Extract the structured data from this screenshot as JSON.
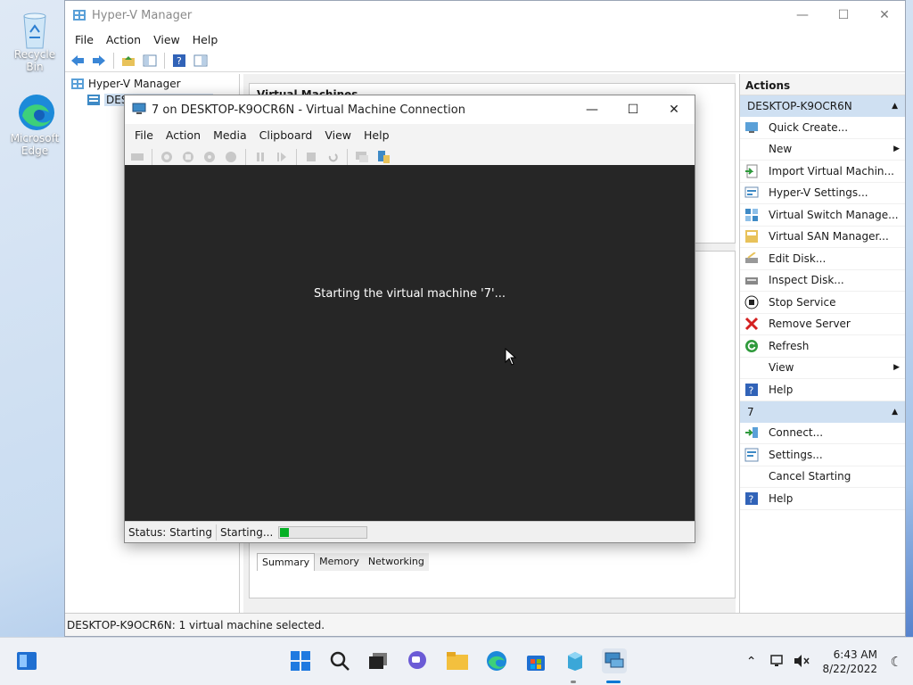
{
  "desktop": {
    "icons": [
      {
        "label": "Recycle Bin",
        "icon": "recycle-bin-icon"
      },
      {
        "label": "Microsoft Edge",
        "icon": "edge-icon"
      }
    ]
  },
  "hyperv": {
    "title": "Hyper-V Manager",
    "menu": [
      "File",
      "Action",
      "View",
      "Help"
    ],
    "tree": {
      "root": "Hyper-V Manager",
      "child": "DESKTOP-K9OCR6N"
    },
    "center": {
      "vm_header": "Virtual Machines",
      "tabs": [
        "Summary",
        "Memory",
        "Networking"
      ]
    },
    "actions": {
      "header": "Actions",
      "server_section": "DESKTOP-K9OCR6N",
      "server_items": [
        {
          "label": "Quick Create...",
          "icon": "quick-create-icon"
        },
        {
          "label": "New",
          "icon": "",
          "submenu": true
        },
        {
          "label": "Import Virtual Machin...",
          "icon": "import-vm-icon"
        },
        {
          "label": "Hyper-V Settings...",
          "icon": "hyperv-settings-icon"
        },
        {
          "label": "Virtual Switch Manage...",
          "icon": "virtual-switch-icon"
        },
        {
          "label": "Virtual SAN Manager...",
          "icon": "virtual-san-icon"
        },
        {
          "label": "Edit Disk...",
          "icon": "edit-disk-icon"
        },
        {
          "label": "Inspect Disk...",
          "icon": "inspect-disk-icon"
        },
        {
          "label": "Stop Service",
          "icon": "stop-service-icon"
        },
        {
          "label": "Remove Server",
          "icon": "remove-server-icon"
        },
        {
          "label": "Refresh",
          "icon": "refresh-icon"
        },
        {
          "label": "View",
          "icon": "",
          "submenu": true
        },
        {
          "label": "Help",
          "icon": "help-icon"
        }
      ],
      "vm_section": "7",
      "vm_items": [
        {
          "label": "Connect...",
          "icon": "connect-icon"
        },
        {
          "label": "Settings...",
          "icon": "settings-icon"
        },
        {
          "label": "Cancel Starting",
          "icon": ""
        },
        {
          "label": "Help",
          "icon": "help-icon"
        }
      ]
    },
    "status": "DESKTOP-K9OCR6N:  1 virtual machine selected."
  },
  "vmconnect": {
    "title": "7 on DESKTOP-K9OCR6N - Virtual Machine Connection",
    "menu": [
      "File",
      "Action",
      "Media",
      "Clipboard",
      "View",
      "Help"
    ],
    "screen_message": "Starting the virtual machine '7'...",
    "status": "Status: Starting",
    "progress_label": "Starting...",
    "progress_fraction": 0.1
  },
  "taskbar": {
    "time": "6:43 AM",
    "date": "8/22/2022"
  },
  "colors": {
    "accent": "#0078d4",
    "progress": "#06b025",
    "vm_screen": "#262626"
  }
}
